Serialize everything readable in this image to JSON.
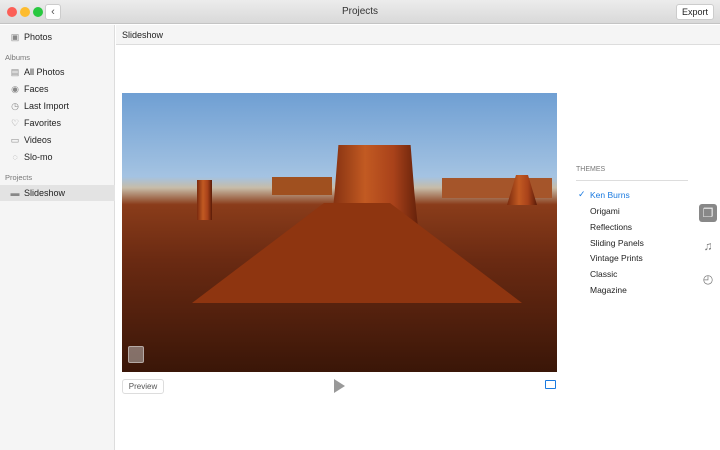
{
  "window": {
    "title": "Projects",
    "export_label": "Export",
    "back_icon": "chevron-left-icon"
  },
  "sidebar": {
    "photos": "Photos",
    "albums_header": "Albums",
    "albums": [
      {
        "label": "All Photos",
        "icon": "photos-icon"
      },
      {
        "label": "Faces",
        "icon": "face-icon"
      },
      {
        "label": "Last Import",
        "icon": "clock-icon"
      },
      {
        "label": "Favorites",
        "icon": "heart-icon"
      },
      {
        "label": "Videos",
        "icon": "video-icon"
      },
      {
        "label": "Slo-mo",
        "icon": "slomo-icon"
      }
    ],
    "projects_header": "Projects",
    "projects": [
      {
        "label": "Slideshow",
        "icon": "slideshow-icon",
        "selected": true
      }
    ]
  },
  "main": {
    "header": "Slideshow",
    "preview_label": "Preview"
  },
  "themes": {
    "header": "THEMES",
    "selected": "Ken Burns",
    "items": [
      "Ken Burns",
      "Origami",
      "Reflections",
      "Sliding Panels",
      "Vintage Prints",
      "Classic",
      "Magazine"
    ]
  },
  "colors": {
    "accent": "#1a7ae0"
  }
}
